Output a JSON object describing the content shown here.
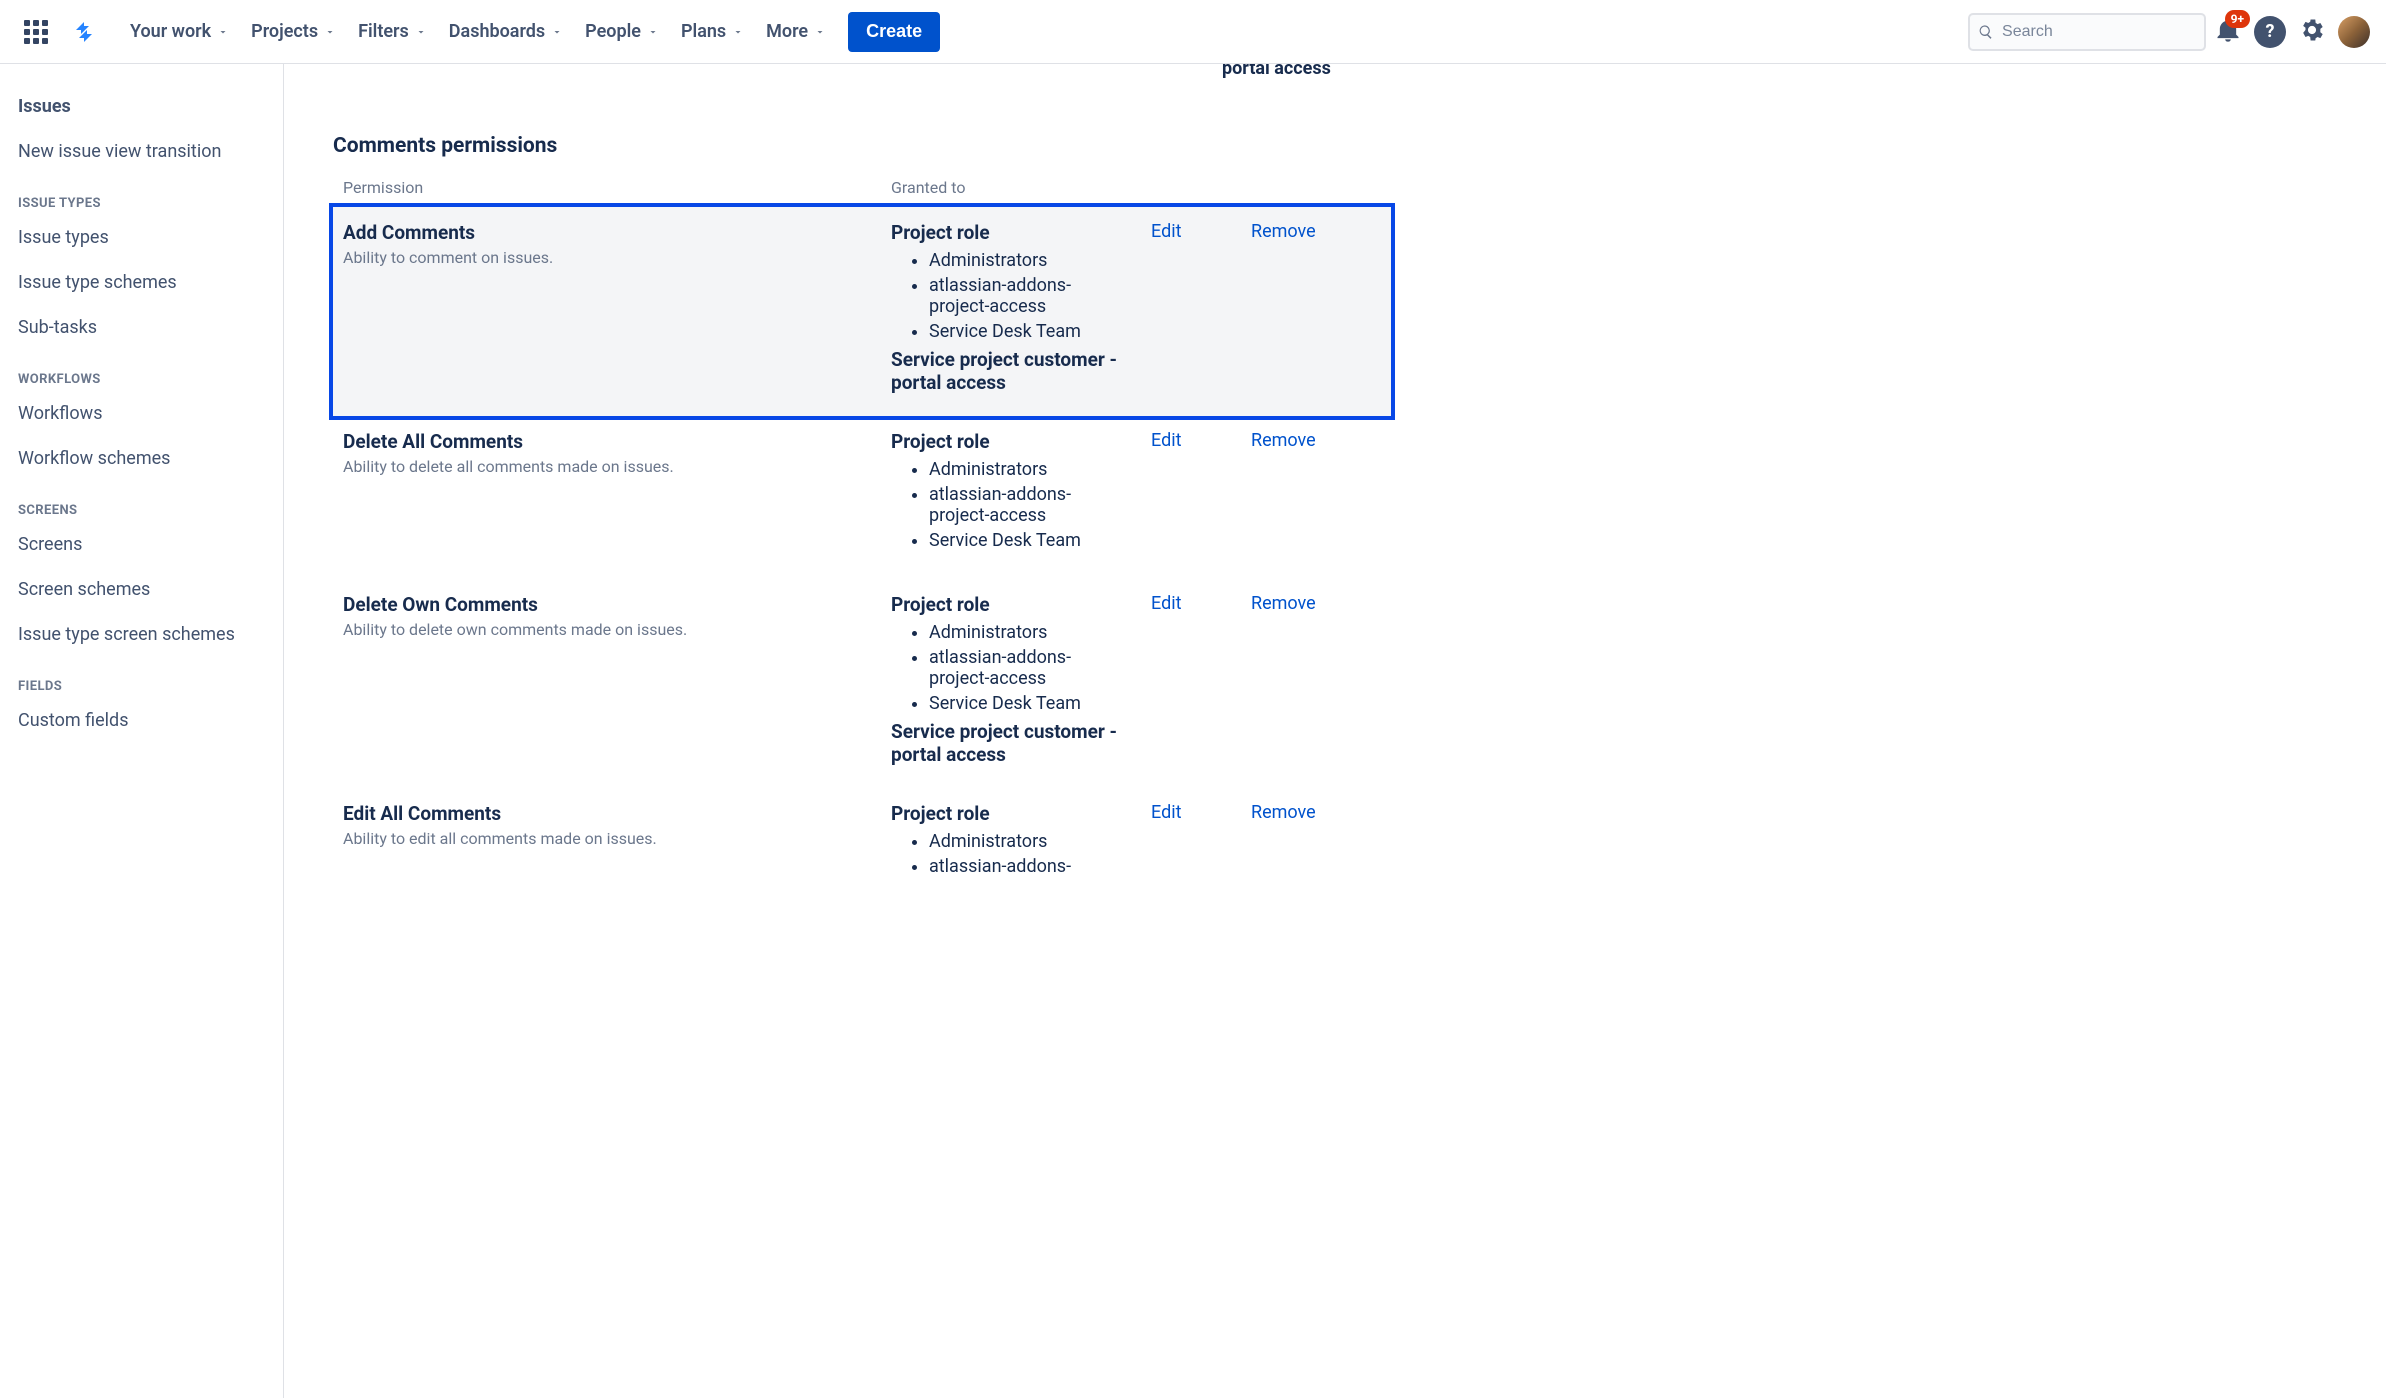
{
  "topnav": {
    "items": [
      "Your work",
      "Projects",
      "Filters",
      "Dashboards",
      "People",
      "Plans",
      "More"
    ],
    "create": "Create",
    "search_placeholder": "Search",
    "badge": "9+"
  },
  "sidebar": {
    "header": "Issues",
    "top_link": "New issue view transition",
    "groups": [
      {
        "label": "ISSUE TYPES",
        "items": [
          "Issue types",
          "Issue type schemes",
          "Sub-tasks"
        ]
      },
      {
        "label": "WORKFLOWS",
        "items": [
          "Workflows",
          "Workflow schemes"
        ]
      },
      {
        "label": "SCREENS",
        "items": [
          "Screens",
          "Screen schemes",
          "Issue type screen schemes"
        ]
      },
      {
        "label": "FIELDS",
        "items": [
          "Custom fields"
        ]
      }
    ]
  },
  "clipped_top_text": "portal access",
  "section_title": "Comments permissions",
  "table": {
    "headers": {
      "permission": "Permission",
      "granted": "Granted to"
    },
    "edit": "Edit",
    "remove": "Remove",
    "rows": [
      {
        "name": "Add Comments",
        "desc": "Ability to comment on issues.",
        "role_label": "Project role",
        "roles": [
          "Administrators",
          "atlassian-addons-project-access",
          "Service Desk Team"
        ],
        "extra": "Service project customer - portal access",
        "highlight": true
      },
      {
        "name": "Delete All Comments",
        "desc": "Ability to delete all comments made on issues.",
        "role_label": "Project role",
        "roles": [
          "Administrators",
          "atlassian-addons-project-access",
          "Service Desk Team"
        ],
        "extra": ""
      },
      {
        "name": "Delete Own Comments",
        "desc": "Ability to delete own comments made on issues.",
        "role_label": "Project role",
        "roles": [
          "Administrators",
          "atlassian-addons-project-access",
          "Service Desk Team"
        ],
        "extra": "Service project customer - portal access"
      },
      {
        "name": "Edit All Comments",
        "desc": "Ability to edit all comments made on issues.",
        "role_label": "Project role",
        "roles": [
          "Administrators",
          "atlassian-addons-"
        ],
        "extra": ""
      }
    ]
  }
}
